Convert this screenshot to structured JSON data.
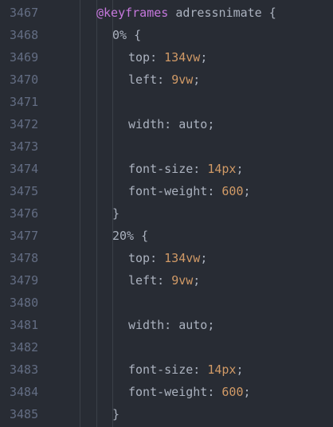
{
  "colors": {
    "background": "#282c34",
    "line_number": "#636d83",
    "at_rule": "#c678dd",
    "number": "#d19a66",
    "unit": "#e06c75",
    "text": "#abb2bf"
  },
  "lines": [
    {
      "num": "3467",
      "indent": 0,
      "tokens": [
        {
          "t": "@keyframes",
          "c": "tok-at"
        },
        {
          "t": " adressnimate {",
          "c": "tok-name"
        }
      ]
    },
    {
      "num": "3468",
      "indent": 1,
      "tokens": [
        {
          "t": "0% {",
          "c": "tok-sel"
        }
      ]
    },
    {
      "num": "3469",
      "indent": 2,
      "tokens": [
        {
          "t": "top: ",
          "c": "tok-prop"
        },
        {
          "t": "134",
          "c": "tok-num"
        },
        {
          "t": "vw",
          "c": "tok-num"
        },
        {
          "t": ";",
          "c": "tok-punc"
        }
      ]
    },
    {
      "num": "3470",
      "indent": 2,
      "tokens": [
        {
          "t": "left: ",
          "c": "tok-prop"
        },
        {
          "t": "9",
          "c": "tok-num"
        },
        {
          "t": "vw",
          "c": "tok-num"
        },
        {
          "t": ";",
          "c": "tok-punc"
        }
      ]
    },
    {
      "num": "3471",
      "indent": 2,
      "tokens": []
    },
    {
      "num": "3472",
      "indent": 2,
      "tokens": [
        {
          "t": "width: ",
          "c": "tok-prop"
        },
        {
          "t": "auto",
          "c": "tok-kw"
        },
        {
          "t": ";",
          "c": "tok-punc"
        }
      ]
    },
    {
      "num": "3473",
      "indent": 2,
      "tokens": []
    },
    {
      "num": "3474",
      "indent": 2,
      "tokens": [
        {
          "t": "font-size: ",
          "c": "tok-prop"
        },
        {
          "t": "14",
          "c": "tok-num"
        },
        {
          "t": "px",
          "c": "tok-num"
        },
        {
          "t": ";",
          "c": "tok-punc"
        }
      ]
    },
    {
      "num": "3475",
      "indent": 2,
      "tokens": [
        {
          "t": "font-weight: ",
          "c": "tok-prop"
        },
        {
          "t": "600",
          "c": "tok-num"
        },
        {
          "t": ";",
          "c": "tok-punc"
        }
      ]
    },
    {
      "num": "3476",
      "indent": 1,
      "tokens": [
        {
          "t": "}",
          "c": "tok-punc"
        }
      ]
    },
    {
      "num": "3477",
      "indent": 1,
      "tokens": [
        {
          "t": "20% {",
          "c": "tok-sel"
        }
      ]
    },
    {
      "num": "3478",
      "indent": 2,
      "tokens": [
        {
          "t": "top: ",
          "c": "tok-prop"
        },
        {
          "t": "134",
          "c": "tok-num"
        },
        {
          "t": "vw",
          "c": "tok-num"
        },
        {
          "t": ";",
          "c": "tok-punc"
        }
      ]
    },
    {
      "num": "3479",
      "indent": 2,
      "tokens": [
        {
          "t": "left: ",
          "c": "tok-prop"
        },
        {
          "t": "9",
          "c": "tok-num"
        },
        {
          "t": "vw",
          "c": "tok-num"
        },
        {
          "t": ";",
          "c": "tok-punc"
        }
      ]
    },
    {
      "num": "3480",
      "indent": 2,
      "tokens": []
    },
    {
      "num": "3481",
      "indent": 2,
      "tokens": [
        {
          "t": "width: ",
          "c": "tok-prop"
        },
        {
          "t": "auto",
          "c": "tok-kw"
        },
        {
          "t": ";",
          "c": "tok-punc"
        }
      ]
    },
    {
      "num": "3482",
      "indent": 2,
      "tokens": []
    },
    {
      "num": "3483",
      "indent": 2,
      "tokens": [
        {
          "t": "font-size: ",
          "c": "tok-prop"
        },
        {
          "t": "14",
          "c": "tok-num"
        },
        {
          "t": "px",
          "c": "tok-num"
        },
        {
          "t": ";",
          "c": "tok-punc"
        }
      ]
    },
    {
      "num": "3484",
      "indent": 2,
      "tokens": [
        {
          "t": "font-weight: ",
          "c": "tok-prop"
        },
        {
          "t": "600",
          "c": "tok-num"
        },
        {
          "t": ";",
          "c": "tok-punc"
        }
      ]
    },
    {
      "num": "3485",
      "indent": 1,
      "tokens": [
        {
          "t": "}",
          "c": "tok-punc"
        }
      ]
    }
  ]
}
